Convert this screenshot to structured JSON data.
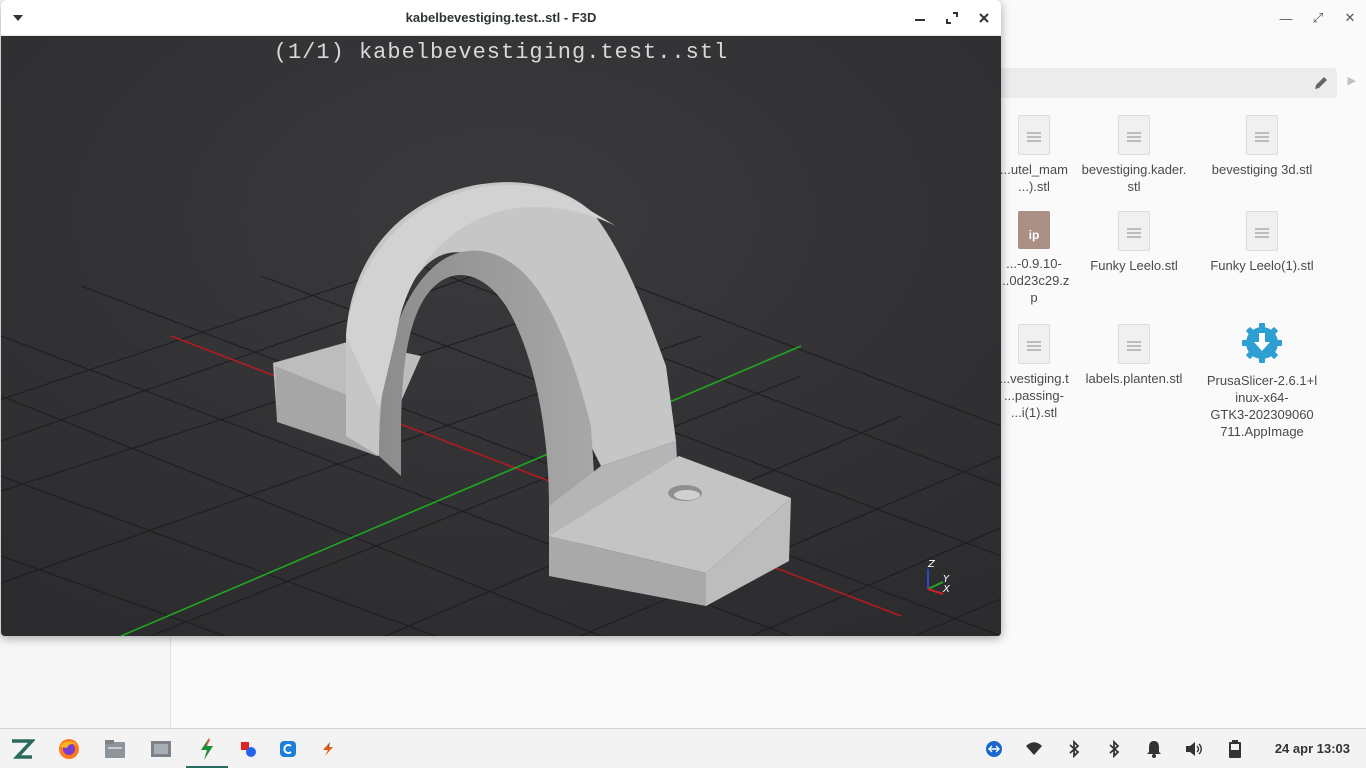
{
  "file_manager": {
    "files": [
      {
        "name": "...utel_mam\n...).stl",
        "type": "doc"
      },
      {
        "name": "bevestiging.kader.\nstl",
        "type": "doc"
      },
      {
        "name": "bevestiging 3d.stl",
        "type": "doc"
      },
      {
        "name": "...-0.9.10-\n...0d23c29.z\np",
        "type": "zip",
        "badge": "ip"
      },
      {
        "name": "Funky Leelo.stl",
        "type": "doc"
      },
      {
        "name": "Funky Leelo(1).stl",
        "type": "doc"
      },
      {
        "name": "...vestiging.t\n...passing-\n...i(1).stl",
        "type": "doc"
      },
      {
        "name": "labels.planten.stl",
        "type": "doc"
      },
      {
        "name": "PrusaSlicer-2.6.1+l\ninux-x64-\nGTK3-202309060\n711.AppImage",
        "type": "appimage"
      }
    ]
  },
  "f3d": {
    "window_title": "kabelbevestiging.test..stl - F3D",
    "viewport_title": "(1/1) kabelbevestiging.test..stl",
    "axes": {
      "z": "Z",
      "y": "Y",
      "x": "X"
    },
    "colors": {
      "background": "#333336",
      "model": "#b8b8b8",
      "x_axis": "#b01c1c",
      "y_axis": "#1fa81f"
    }
  },
  "taskbar": {
    "apps": [
      "zorin-menu",
      "firefox",
      "files",
      "screenshot",
      "kiro",
      "settings",
      "chrome-like",
      "slicer"
    ],
    "clock": "24 apr 13:03"
  }
}
